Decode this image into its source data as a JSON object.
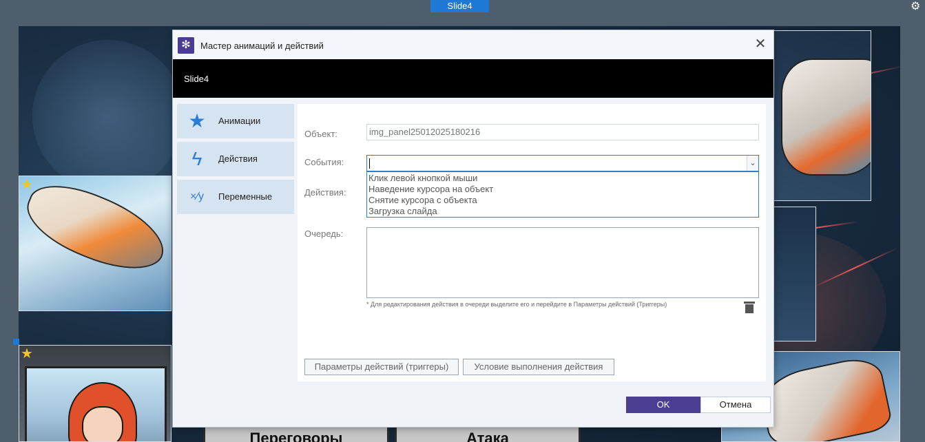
{
  "top_bar": {
    "slide_tab_label": "Slide4"
  },
  "background": {
    "cards": [
      "Переговоры",
      "Атака"
    ]
  },
  "dialog": {
    "title": "Мастер анимаций и действий",
    "banner_text": "Slide4",
    "nav": [
      {
        "label": "Анимации",
        "icon": "star-icon"
      },
      {
        "label": "Действия",
        "icon": "lightning-icon"
      },
      {
        "label": "Переменные",
        "icon": "variables-icon"
      }
    ],
    "form": {
      "object_label": "Объект:",
      "object_value": "img_panel25012025180216",
      "events_label": "События:",
      "events_value": "",
      "events_options": [
        "Клик левой кнопкой мыши",
        "Наведение курсора на объект",
        "Снятие курсора с объекта",
        "Загрузка слайда"
      ],
      "actions_label": "Действия:",
      "queue_label": "Очередь:",
      "hint": "* Для редактирования действия в очереди выделите его и перейдите в Параметры действий (Триггеры)"
    },
    "buttons": {
      "params_triggers": "Параметры действий (триггеры)",
      "action_condition": "Условие выполнения действия",
      "ok": "OK",
      "cancel": "Отмена"
    }
  },
  "colors": {
    "accent_purple": "#4b3d91",
    "accent_blue": "#1e78d6",
    "nav_bg": "#d6e3f0",
    "banner_bg": "#000000"
  }
}
